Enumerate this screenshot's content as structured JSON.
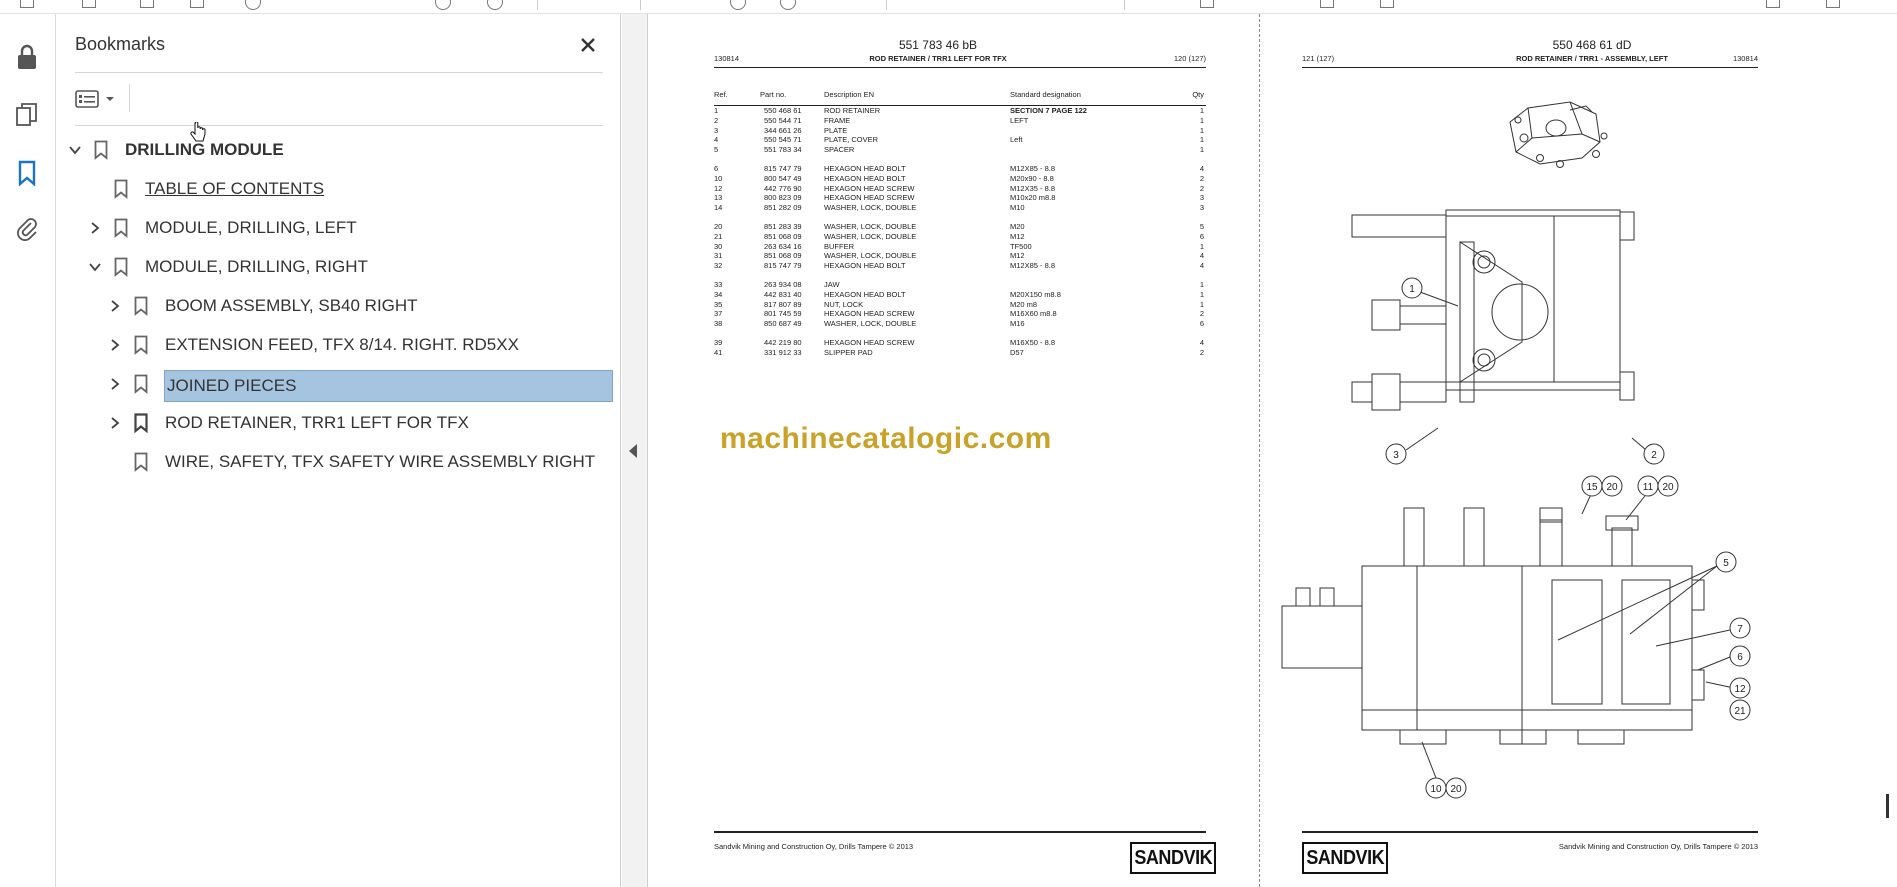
{
  "panel": {
    "title": "Bookmarks"
  },
  "bookmarks": [
    {
      "label": "DRILLING MODULE",
      "state": "expanded",
      "level": 0
    },
    {
      "label": "TABLE OF CONTENTS",
      "state": "leaf",
      "level": 1
    },
    {
      "label": "MODULE, DRILLING, LEFT",
      "state": "collapsed",
      "level": 1
    },
    {
      "label": "MODULE, DRILLING, RIGHT",
      "state": "expanded",
      "level": 1
    },
    {
      "label": "BOOM ASSEMBLY, SB40 RIGHT",
      "state": "collapsed",
      "level": 2
    },
    {
      "label": "EXTENSION FEED, TFX 8/14. RIGHT. RD5XX",
      "state": "collapsed",
      "level": 2
    },
    {
      "label": "JOINED PIECES",
      "state": "collapsed",
      "level": 2,
      "selected": true
    },
    {
      "label": "ROD RETAINER, TRR1 LEFT FOR TFX",
      "state": "collapsed",
      "level": 2
    },
    {
      "label": "WIRE, SAFETY, TFX SAFETY WIRE ASSEMBLY RIGHT",
      "state": "leaf",
      "level": 2
    }
  ],
  "left_page": {
    "doc_number": "551 783 46 bB",
    "code": "130814",
    "title": "ROD RETAINER / TRR1 LEFT FOR TFX",
    "page_ref": "120 (127)",
    "headers": [
      "Ref.",
      "Part no.",
      "Description EN",
      "Standard designation",
      "Qty"
    ],
    "groups": [
      [
        [
          "1",
          "550 468 61",
          "ROD RETAINER",
          "SECTION 7 PAGE 122",
          "1"
        ],
        [
          "2",
          "550 544 71",
          "FRAME",
          "LEFT",
          "1"
        ],
        [
          "3",
          "344 661 26",
          "PLATE",
          "",
          "1"
        ],
        [
          "4",
          "550 545 71",
          "PLATE, COVER",
          "Left",
          "1"
        ],
        [
          "5",
          "551 783 34",
          "SPACER",
          "",
          "1"
        ]
      ],
      [
        [
          "6",
          "815 747 79",
          "HEXAGON HEAD BOLT",
          "M12X85 - 8.8",
          "4"
        ],
        [
          "10",
          "800 547 49",
          "HEXAGON HEAD BOLT",
          "M20x90 - 8.8",
          "2"
        ],
        [
          "12",
          "442 776 90",
          "HEXAGON HEAD SCREW",
          "M12X35 - 8.8",
          "2"
        ],
        [
          "13",
          "800 823 09",
          "HEXAGON HEAD SCREW",
          "M10x20 m8.8",
          "3"
        ],
        [
          "14",
          "851 282 09",
          "WASHER, LOCK, DOUBLE",
          "M10",
          "3"
        ]
      ],
      [
        [
          "20",
          "851 283 39",
          "WASHER, LOCK, DOUBLE",
          "M20",
          "5"
        ],
        [
          "21",
          "851 068 09",
          "WASHER, LOCK, DOUBLE",
          "M12",
          "6"
        ],
        [
          "30",
          "263 634 16",
          "BUFFER",
          "TF500",
          "1"
        ],
        [
          "31",
          "851 068 09",
          "WASHER, LOCK, DOUBLE",
          "M12",
          "4"
        ],
        [
          "32",
          "815 747 79",
          "HEXAGON HEAD BOLT",
          "M12X85 - 8.8",
          "4"
        ]
      ],
      [
        [
          "33",
          "263 934 08",
          "JAW",
          "",
          "1"
        ],
        [
          "34",
          "442 831 40",
          "HEXAGON HEAD BOLT",
          "M20X150 m8.8",
          "1"
        ],
        [
          "35",
          "817 807 89",
          "NUT, LOCK",
          "M20 m8",
          "1"
        ],
        [
          "37",
          "801 745 59",
          "HEXAGON HEAD SCREW",
          "M16X60 m8.8",
          "2"
        ],
        [
          "38",
          "850 687 49",
          "WASHER, LOCK, DOUBLE",
          "M16",
          "6"
        ]
      ],
      [
        [
          "39",
          "442 219 80",
          "HEXAGON HEAD SCREW",
          "M16X50 - 8.8",
          "4"
        ],
        [
          "41",
          "331 912 33",
          "SLIPPER PAD",
          "D57",
          "2"
        ]
      ]
    ],
    "watermark": "machinecatalogic.com",
    "footer": "Sandvik Mining and Construction Oy, Drills Tampere © 2013",
    "logo": "SANDVIK"
  },
  "right_page": {
    "doc_number": "550 468 61 dD",
    "page_ref": "121 (127)",
    "title": "ROD RETAINER / TRR1 - ASSEMBLY, LEFT",
    "code": "130814",
    "footer": "Sandvik Mining and Construction Oy, Drills Tampere © 2013",
    "logo": "SANDVIK",
    "callouts": [
      "1",
      "2",
      "3",
      "15",
      "20",
      "11",
      "20",
      "5",
      "7",
      "6",
      "12",
      "21",
      "10",
      "20"
    ]
  },
  "icons": {
    "rail": [
      "lock-icon",
      "pages-icon",
      "bookmark-icon",
      "attachment-icon"
    ],
    "accent": "#1a73c8",
    "selection": "#a5c4e0"
  }
}
